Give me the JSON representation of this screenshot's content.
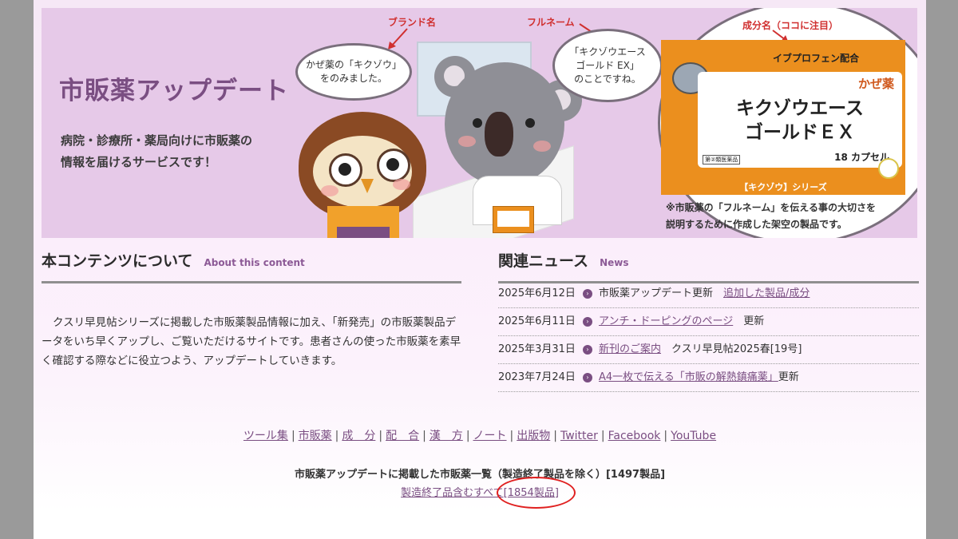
{
  "banner": {
    "title": "市販薬アップデート",
    "subtitle_line1": "病院・診療所・薬局向けに市販薬の",
    "subtitle_line2": "情報を届けるサービスです！",
    "label_brand": "ブランド名",
    "label_fullname": "フルネーム",
    "label_ingredient": "成分名（ココに注目）",
    "bubble_owl_line1": "かぜ薬の「キクゾウ」",
    "bubble_owl_line2": "をのみました。",
    "bubble_koala_line1": "「キクゾウエース",
    "bubble_koala_line2": "ゴールド EX」",
    "bubble_koala_line3": "のことですね。",
    "box_ingredient": "イブプロフェン配合",
    "box_category": "かぜ薬",
    "box_name_line1": "キクゾウエース",
    "box_name_line2": "ゴールドＥＸ",
    "box_capsules": "18 カプセル",
    "box_class": "第②類医薬品",
    "box_series": "【キクゾウ】シリーズ",
    "note_line1": "※市販薬の「フルネーム」を伝える事の大切さを",
    "note_line2": "説明するために作成した架空の製品です。"
  },
  "about": {
    "title": "本コンテンツについて",
    "title_en": "About  this content",
    "text": "クスリ早見帖シリーズに掲載した市販薬製品情報に加え、「新発売」の市販薬製品データをいち早くアップし、ご覧いただけるサイトです。患者さんの使った市販薬を素早く確認する際などに役立つよう、アップデートしていきます。"
  },
  "news": {
    "title": "関連ニュース",
    "title_en": "News",
    "items": [
      {
        "date": "2025年6月12日",
        "pre": "市販薬アップデート更新　",
        "link": "追加した製品/成分",
        "post": ""
      },
      {
        "date": "2025年6月11日",
        "pre": "",
        "link": "アンチ・ドーピングのページ",
        "post": "　更新"
      },
      {
        "date": "2025年3月31日",
        "pre": "",
        "link": "新刊のご案内",
        "post": "　クスリ早見帖2025春[19号]"
      },
      {
        "date": "2023年7月24日",
        "pre": "",
        "link": "A4一枚で伝える「市販の解熱鎮痛薬」",
        "post": "更新"
      }
    ]
  },
  "footer": {
    "links": [
      "ツール集",
      "市販薬",
      "成　分",
      "配　合",
      "漢　方",
      "ノート",
      "出版物",
      "Twitter",
      "Facebook",
      "YouTube"
    ],
    "list_title": "市販薬アップデートに掲載した市販薬一覧（製造終了製品を除く）[1497製品]",
    "list_all": "製造終了品含むすべて[1854製品]"
  },
  "colors": {
    "accent": "#7a4e82",
    "banner_bg": "#e6c9e8",
    "annotation_red": "#e02020"
  }
}
